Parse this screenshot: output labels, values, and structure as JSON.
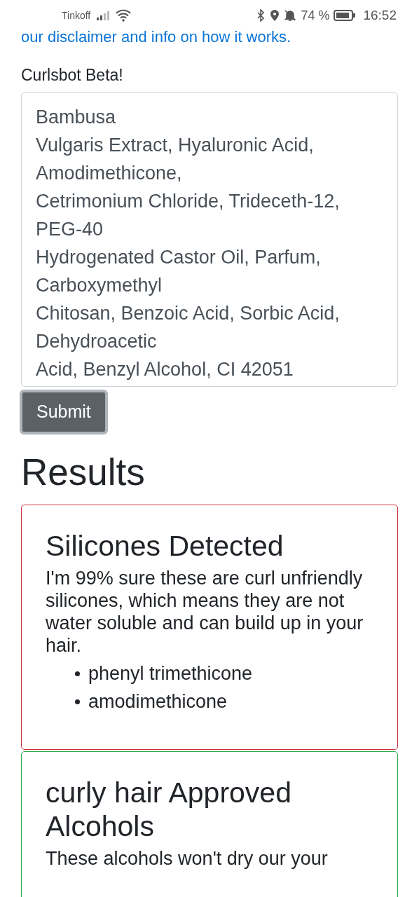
{
  "status_bar": {
    "carrier": "Tinkoff",
    "battery": "74 %",
    "time": "16:52"
  },
  "intro_link": "our disclaimer and info on how it works.",
  "form": {
    "label": "Curlsbot Beta!",
    "field_lines": [
      "Bambusa",
      "Vulgaris Extract, Hyaluronic Acid,",
      "Amodimethicone,",
      "Cetrimonium Chloride, Trideceth-12,",
      "PEG-40",
      "Hydrogenated Castor Oil, Parfum,",
      "Carboxymethyl",
      "Chitosan, Benzoic Acid, Sorbic Acid,",
      "Dehydroacetic",
      "Acid, Benzyl Alcohol, CI 42051"
    ],
    "submit": "Submit"
  },
  "results": {
    "heading": "Results",
    "cards": [
      {
        "kind": "danger",
        "title": "Silicones Detected",
        "text": "I'm 99% sure these are curl unfriendly silicones, which means they are not water soluble and can build up in your hair.",
        "items": [
          "phenyl trimethicone",
          "amodimethicone"
        ]
      },
      {
        "kind": "success",
        "title": "curly hair Approved Alcohols",
        "text": "These alcohols won't dry our your"
      }
    ]
  }
}
